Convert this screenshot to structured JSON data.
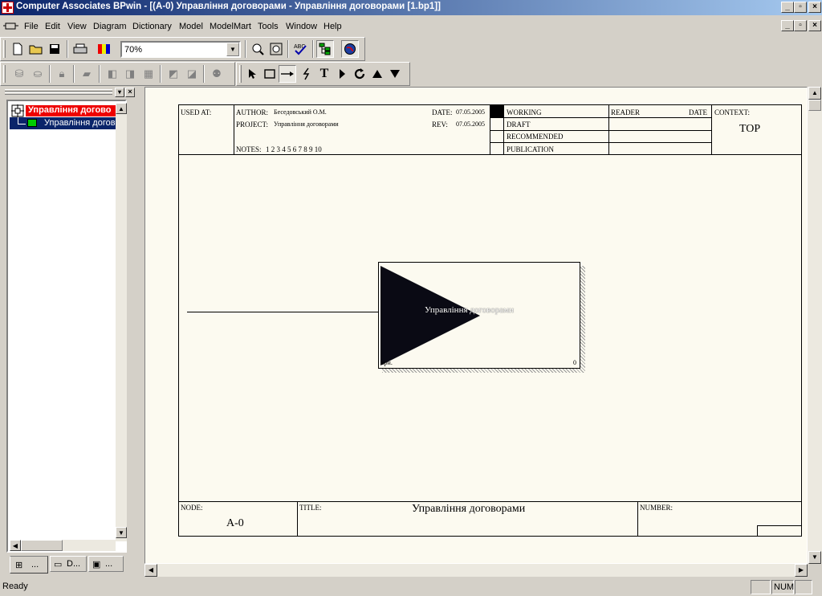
{
  "window": {
    "title": "Computer Associates BPwin - [(A-0) Управління договорами - Управління договорами  [1.bp1]]"
  },
  "menu": [
    "File",
    "Edit",
    "View",
    "Diagram",
    "Dictionary",
    "Model",
    "ModelMart",
    "Tools",
    "Window",
    "Help"
  ],
  "toolbar": {
    "zoom_value": "70%"
  },
  "explorer": {
    "root_label": "Управління догово",
    "child_label": "Управління догов",
    "tabs": [
      "...",
      "D...",
      "..."
    ]
  },
  "diagram": {
    "used_at_label": "USED AT:",
    "author_label": "AUTHOR:",
    "author": "Беседовський О.М.",
    "project_label": "PROJECT:",
    "project": "Управління договорами",
    "date_label": "DATE:",
    "date": "07.05.2005",
    "rev_label": "REV:",
    "rev": "07.05.2005",
    "notes_label": "NOTES:",
    "notes": "1 2 3 4 5 6 7 8 9 10",
    "status_items": [
      "WORKING",
      "DRAFT",
      "RECOMMENDED",
      "PUBLICATION"
    ],
    "reader_label": "READER",
    "reader_date_label": "DATE",
    "context_label": "CONTEXT:",
    "context_value": "TOP",
    "box_label": "Управління договорами",
    "box_corner": "0",
    "box_bottom_left": "арн.",
    "node_label": "NODE:",
    "node_value": "A-0",
    "title_label": "TITLE:",
    "title_value": "Управління договорами",
    "number_label": "NUMBER:"
  },
  "status": {
    "text": "Ready",
    "num": "NUM"
  }
}
